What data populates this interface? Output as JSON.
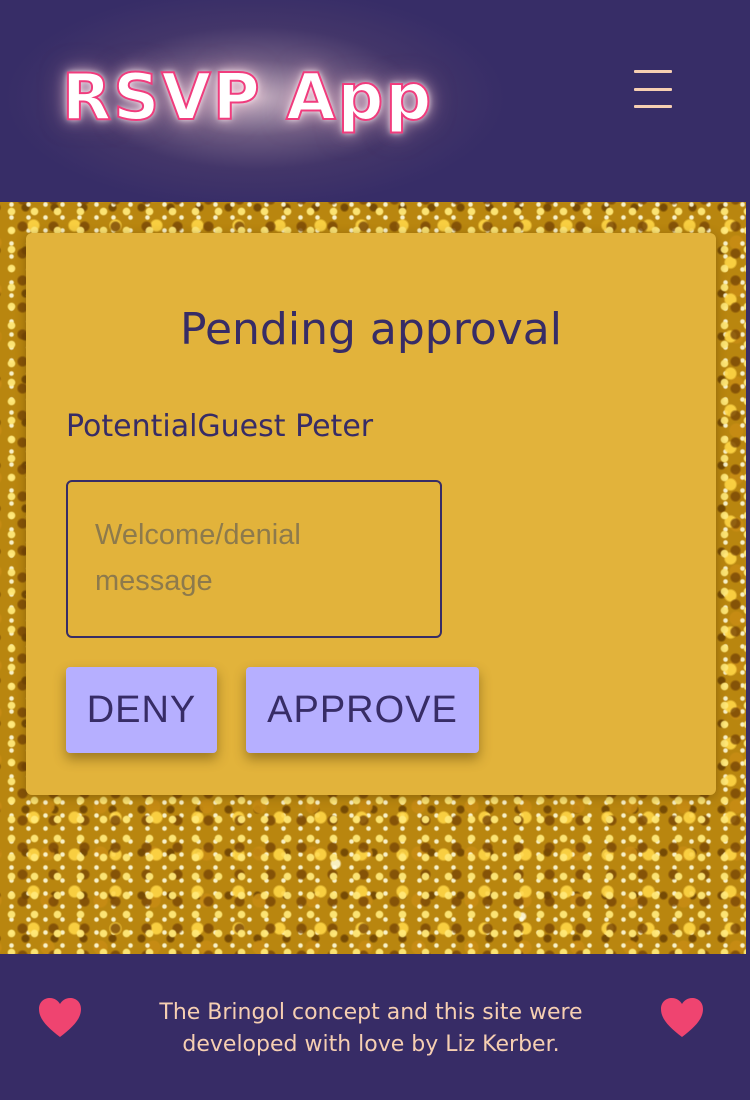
{
  "header": {
    "logo_text": "RSVP App",
    "menu_icon": "hamburger-menu-icon"
  },
  "pending": {
    "title": "Pending approval",
    "guest_name": "PotentialGuest Peter",
    "message_placeholder": "Welcome/denial message",
    "message_value": "",
    "deny_label": "DENY",
    "approve_label": "APPROVE"
  },
  "footer": {
    "text": "The Bringol concept and this site were developed with love by Liz Kerber.",
    "heart_icon": "heart-icon"
  },
  "colors": {
    "header_bg": "#372d67",
    "logo_stroke": "#f03c7d",
    "card_bg": "#e2b33b",
    "text_primary": "#372c66",
    "button_bg": "#b6afff",
    "footer_text": "#f6cfb2",
    "heart": "#ef4470"
  }
}
